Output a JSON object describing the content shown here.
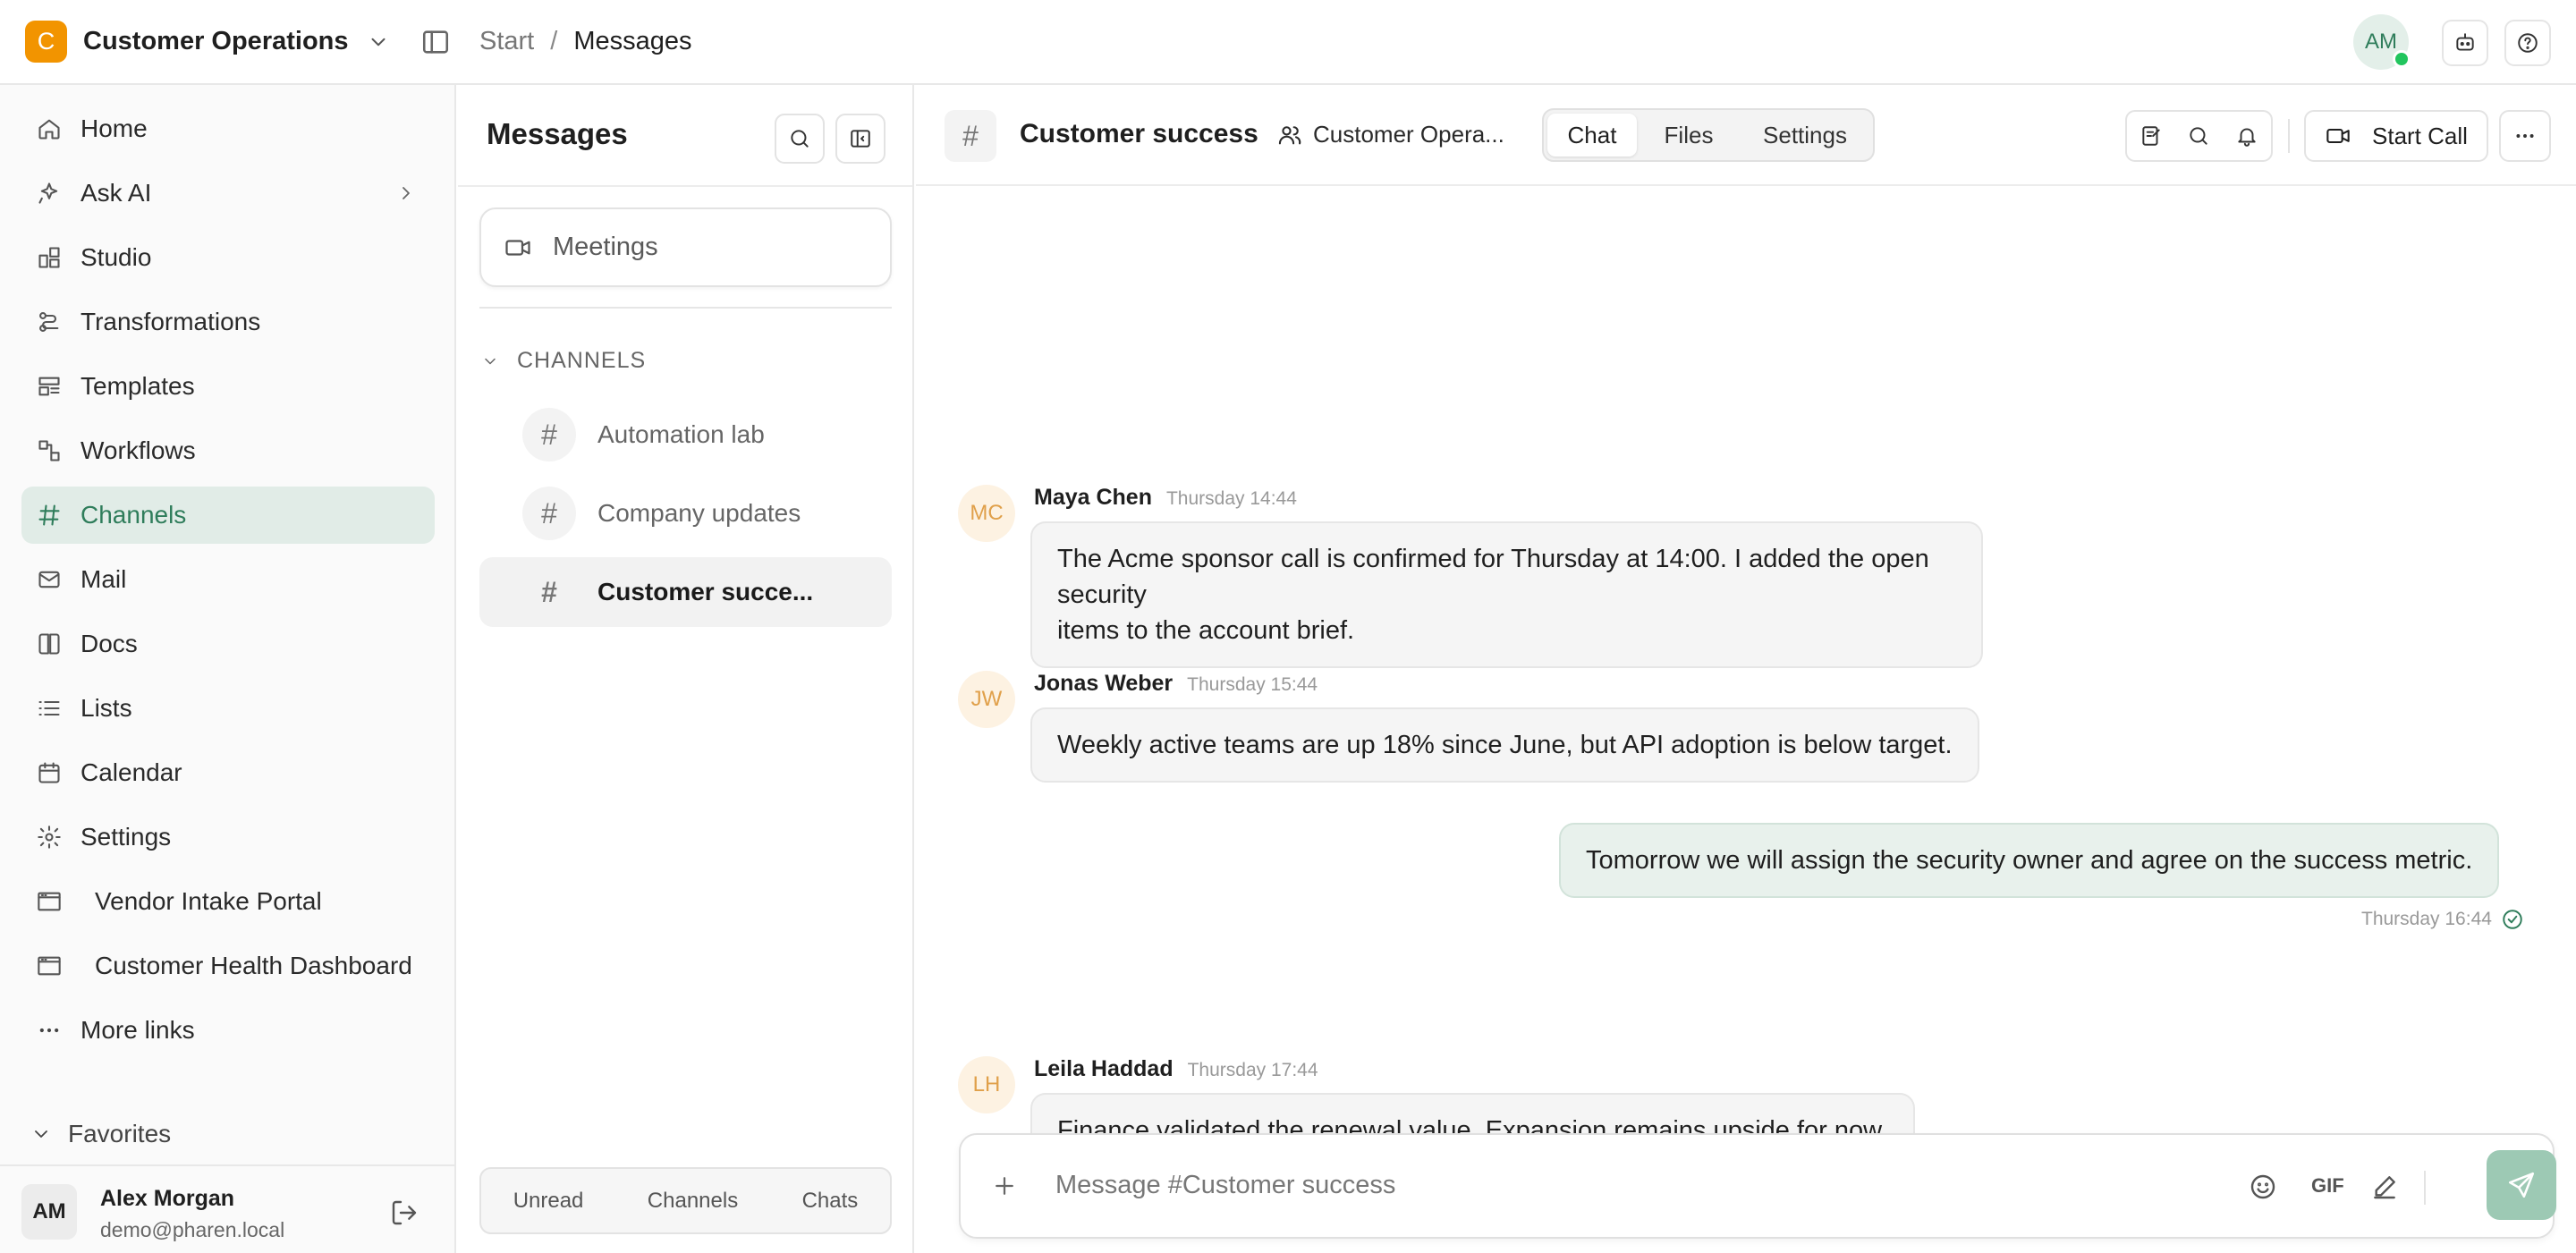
{
  "workspace": {
    "initial": "C",
    "name": "Customer Operations"
  },
  "breadcrumb": {
    "start": "Start",
    "separator": "/",
    "current": "Messages"
  },
  "user": {
    "initials": "AM",
    "name": "Alex Morgan",
    "email": "demo@pharen.local"
  },
  "sidebar": {
    "items": [
      {
        "label": "Home",
        "icon": "home-icon"
      },
      {
        "label": "Ask AI",
        "icon": "sparkle-icon"
      },
      {
        "label": "Studio",
        "icon": "studio-icon"
      },
      {
        "label": "Transformations",
        "icon": "transform-icon"
      },
      {
        "label": "Templates",
        "icon": "template-icon"
      },
      {
        "label": "Workflows",
        "icon": "workflow-icon"
      },
      {
        "label": "Channels",
        "icon": "hash-icon",
        "active": true
      },
      {
        "label": "Mail",
        "icon": "mail-icon"
      },
      {
        "label": "Docs",
        "icon": "book-icon"
      },
      {
        "label": "Lists",
        "icon": "list-icon"
      },
      {
        "label": "Calendar",
        "icon": "calendar-icon"
      },
      {
        "label": "Settings",
        "icon": "gear-icon"
      },
      {
        "label": "Vendor Intake Portal",
        "icon": "app-window-icon"
      },
      {
        "label": "Customer Health Dashboard",
        "icon": "app-window-icon"
      },
      {
        "label": "More links",
        "icon": "dots-icon"
      }
    ],
    "favorites_label": "Favorites"
  },
  "messages_panel": {
    "title": "Messages",
    "meetings_label": "Meetings",
    "channels_heading": "CHANNELS",
    "channels": [
      {
        "label": "Automation lab"
      },
      {
        "label": "Company updates"
      },
      {
        "label": "Customer succe...",
        "active": true
      }
    ],
    "footer_tabs": [
      "Unread",
      "Channels",
      "Chats"
    ]
  },
  "chat": {
    "channel_symbol": "#",
    "title": "Customer success",
    "team": "Customer Opera...",
    "tabs": [
      {
        "label": "Chat",
        "active": true
      },
      {
        "label": "Files"
      },
      {
        "label": "Settings"
      }
    ],
    "call_label": "Start Call",
    "messages": [
      {
        "initials": "MC",
        "author": "Maya Chen",
        "time": "Thursday 14:44",
        "line1": "The Acme sponsor call is confirmed for Thursday at 14:00. I added the open security",
        "line2": "items to the account brief."
      },
      {
        "initials": "JW",
        "author": "Jonas Weber",
        "time": "Thursday 15:44",
        "text": "Weekly active teams are up 18% since June, but API adoption is below target."
      },
      {
        "mine": true,
        "text": "Tomorrow we will assign the security owner and agree on the success metric.",
        "time": "Thursday 16:44"
      },
      {
        "initials": "LH",
        "author": "Leila Haddad",
        "time": "Thursday 17:44",
        "text": "Finance validated the renewal value. Expansion remains upside for now."
      }
    ],
    "composer": {
      "placeholder": "Message #Customer success",
      "gif_label": "GIF"
    }
  },
  "colors": {
    "accent": "#2f7d5b",
    "workspace_logo": "#f29400",
    "online": "#22c55e",
    "active_nav_bg": "#e1ece7"
  }
}
